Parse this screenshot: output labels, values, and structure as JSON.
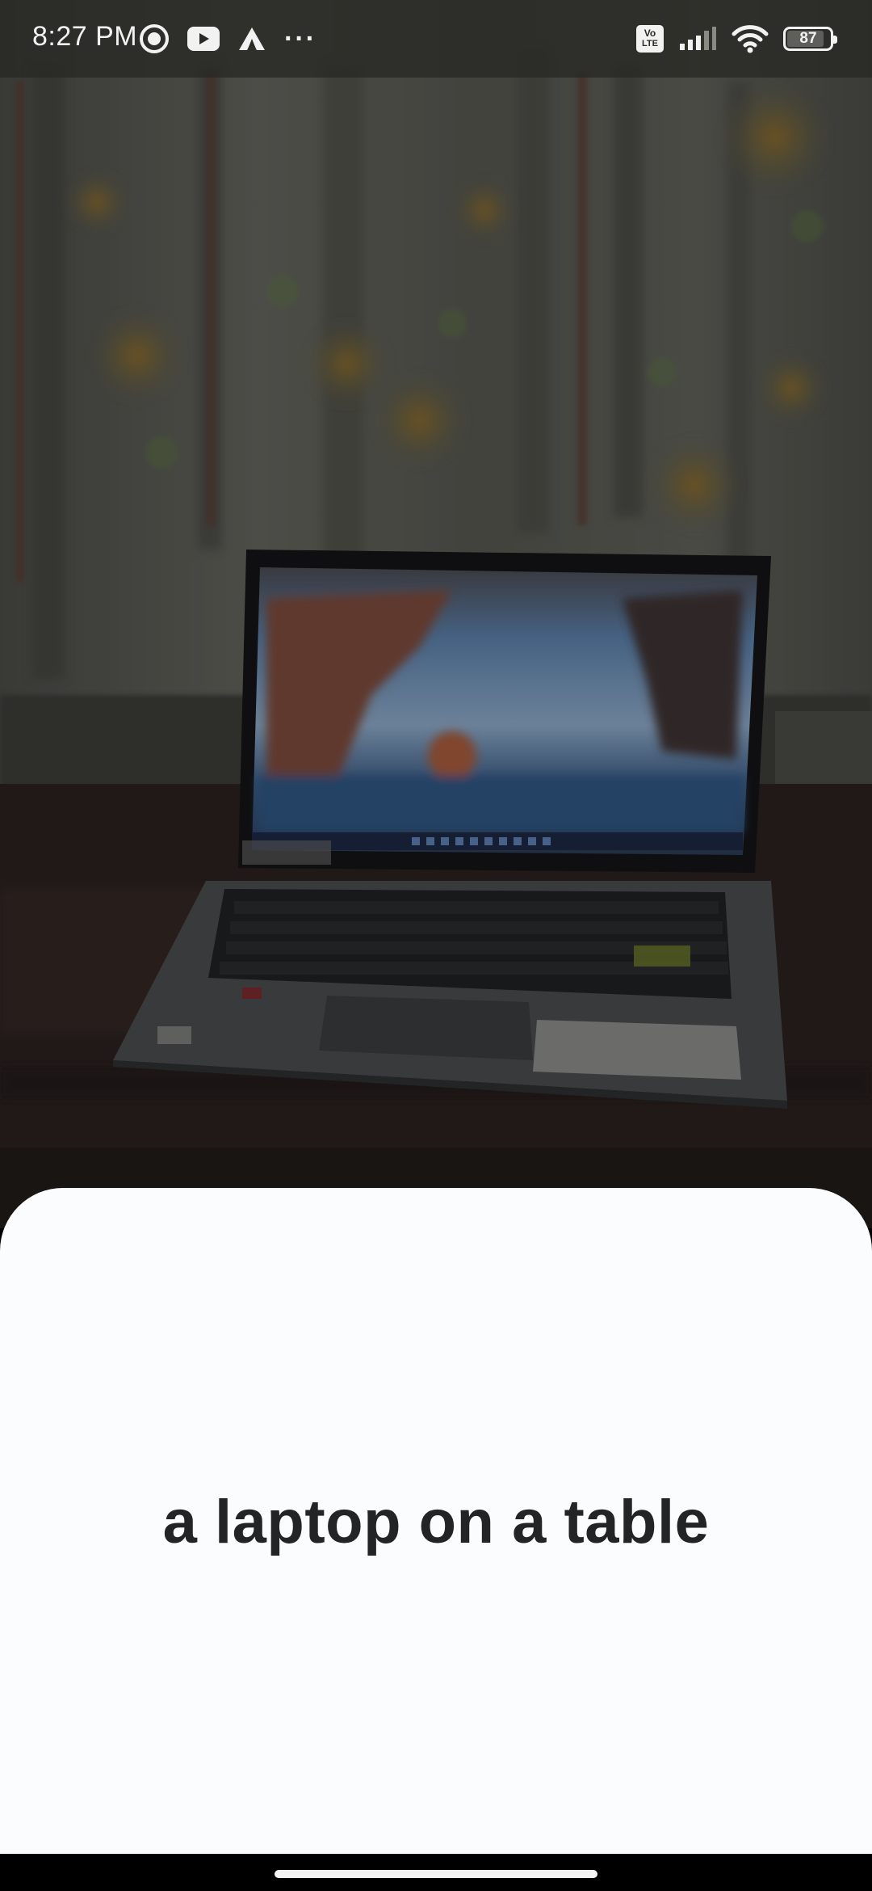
{
  "status_bar": {
    "time": "8:27 PM",
    "left_icons": [
      "record-icon",
      "youtube-icon",
      "axis-app-icon",
      "more-notifications-icon"
    ],
    "more_label": "···",
    "right_icons": [
      "volte-icon",
      "signal-icon",
      "wifi-icon",
      "battery-icon"
    ],
    "volte_line1": "Vo",
    "volte_line2": "LTE",
    "battery_level": "87",
    "battery_fraction": 0.87
  },
  "camera_preview": {
    "scene": "photo-of-laptop-on-table"
  },
  "caption": {
    "text": "a laptop on a table"
  },
  "colors": {
    "sheet_background": "#fbfcfe",
    "caption_text": "#232426",
    "status_bar_background": "#28281f"
  }
}
